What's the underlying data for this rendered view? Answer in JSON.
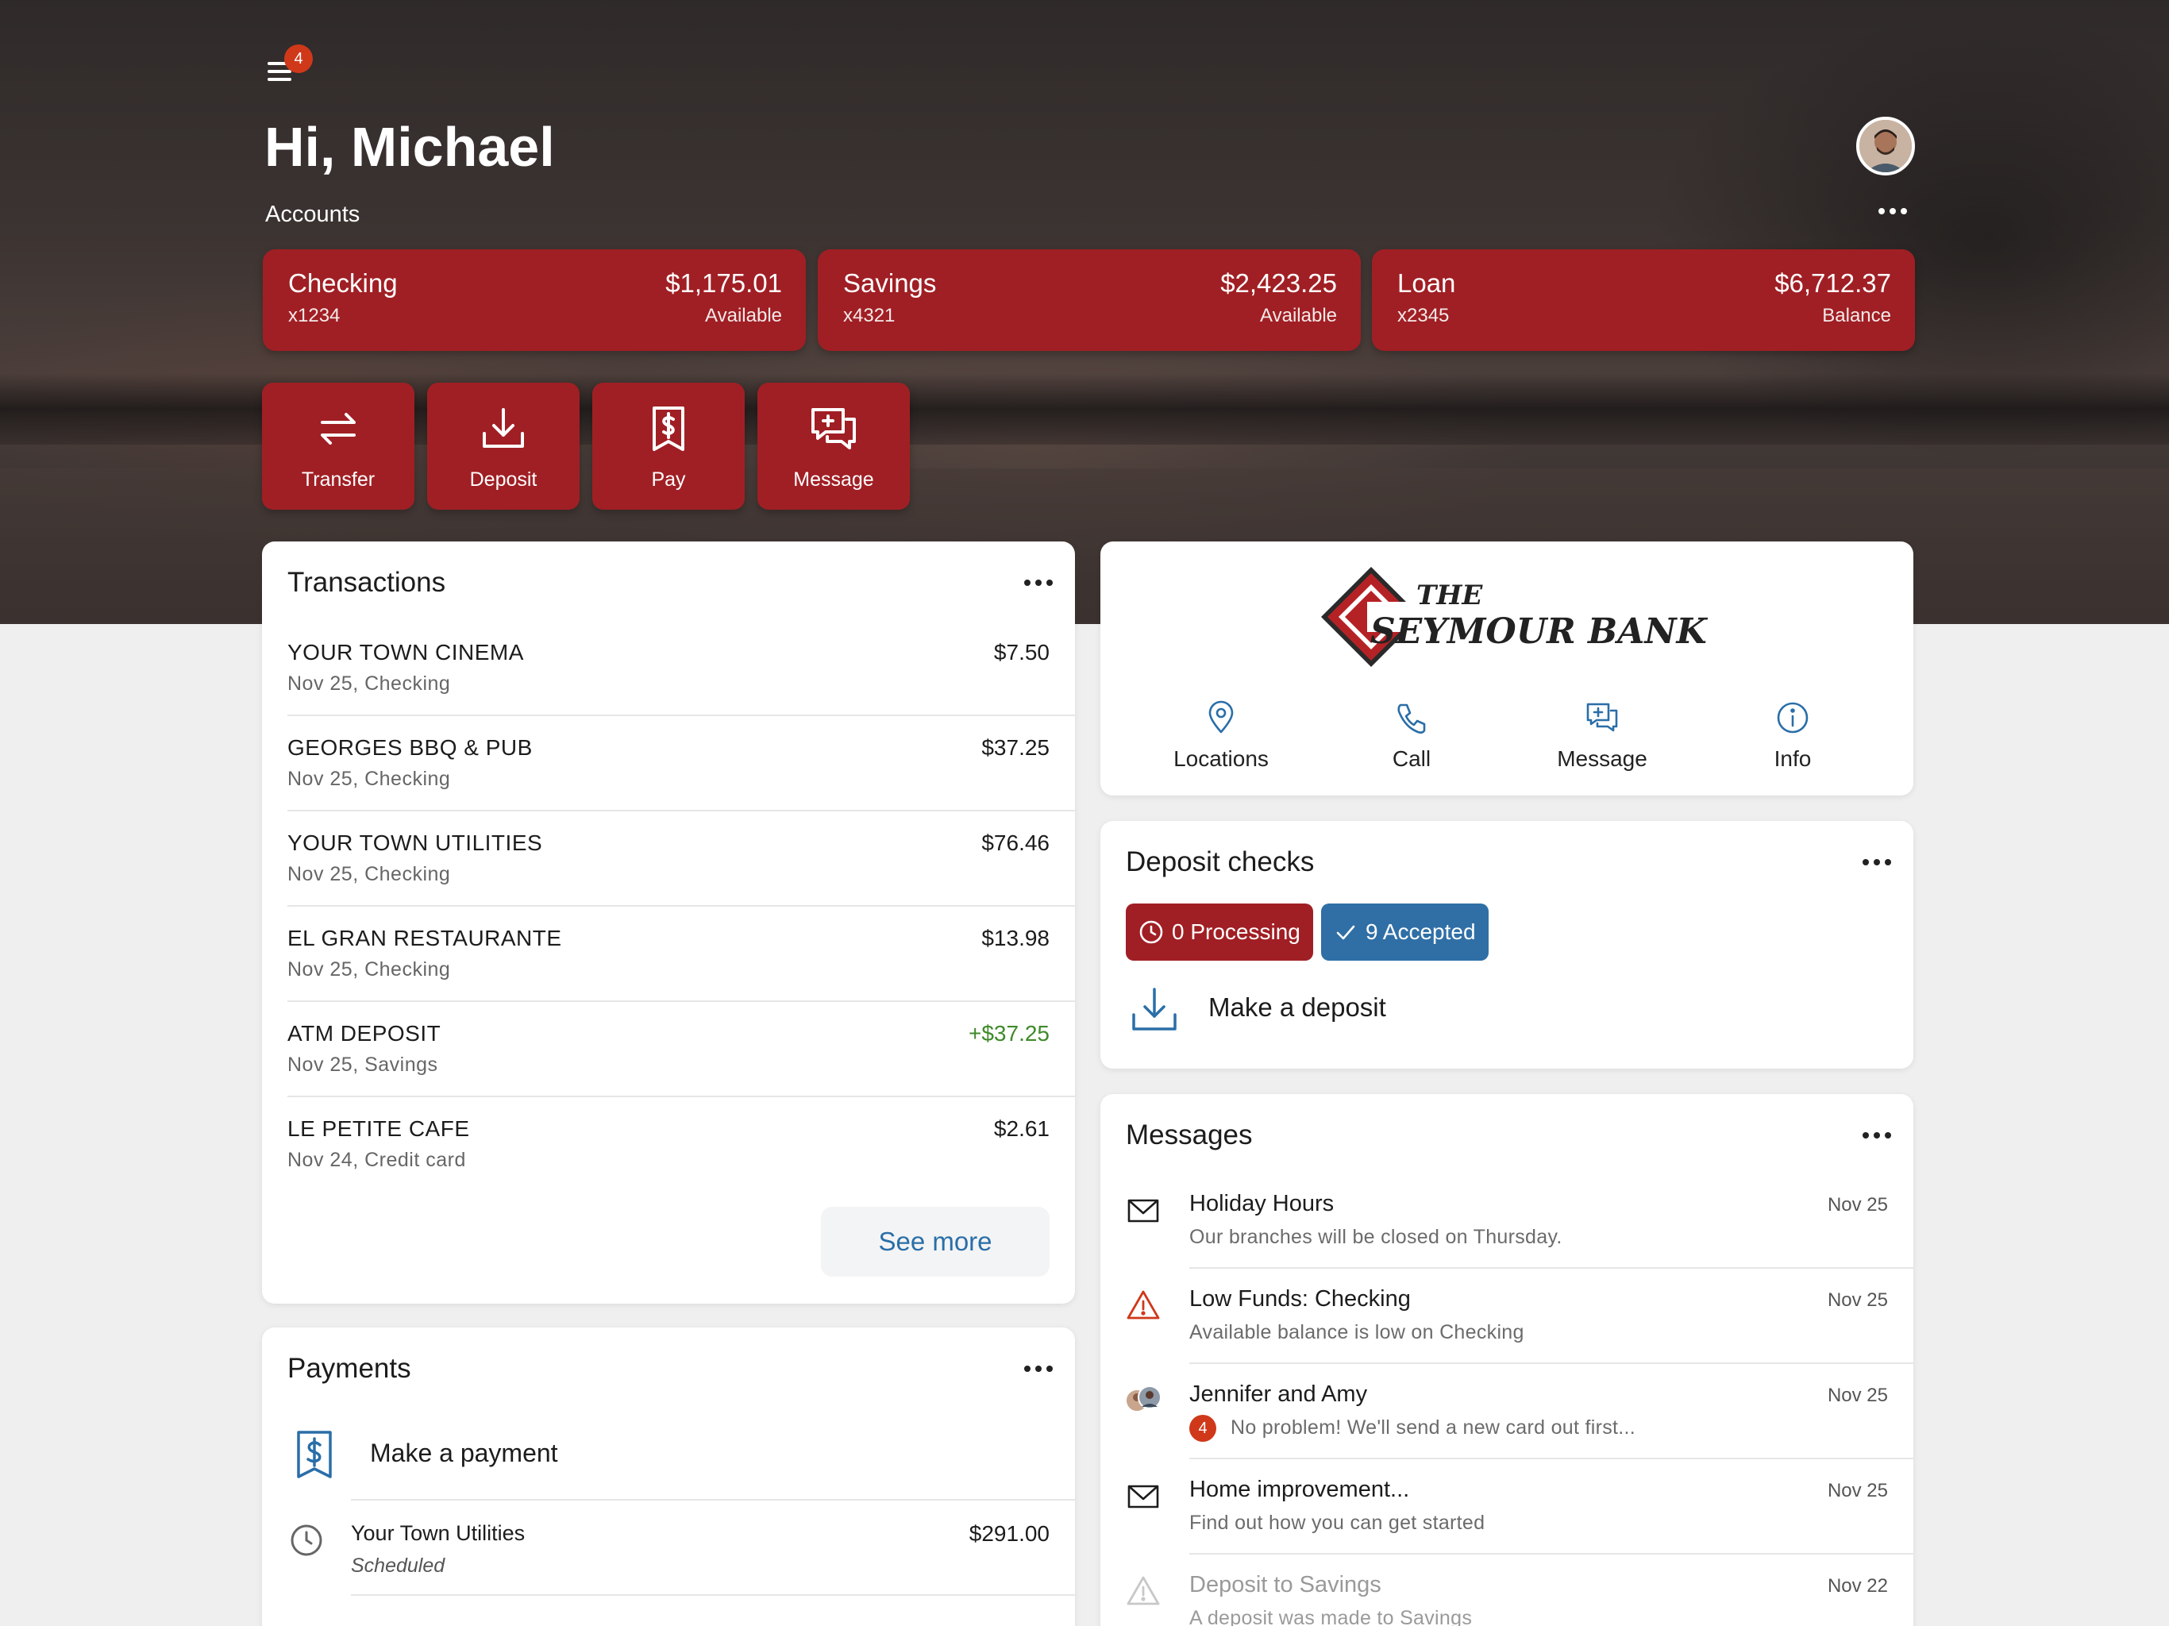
{
  "header": {
    "menu_badge": "4",
    "greeting": "Hi, Michael",
    "accounts_label": "Accounts"
  },
  "accounts": [
    {
      "name": "Checking",
      "number": "x1234",
      "amount": "$1,175.01",
      "sub": "Available"
    },
    {
      "name": "Savings",
      "number": "x4321",
      "amount": "$2,423.25",
      "sub": "Available"
    },
    {
      "name": "Loan",
      "number": "x2345",
      "amount": "$6,712.37",
      "sub": "Balance"
    }
  ],
  "actions": [
    {
      "label": "Transfer",
      "icon": "transfer-icon"
    },
    {
      "label": "Deposit",
      "icon": "deposit-icon"
    },
    {
      "label": "Pay",
      "icon": "pay-icon"
    },
    {
      "label": "Message",
      "icon": "message-icon"
    }
  ],
  "transactions": {
    "title": "Transactions",
    "items": [
      {
        "merchant": "YOUR TOWN CINEMA",
        "detail": "Nov 25, Checking",
        "amount": "$7.50"
      },
      {
        "merchant": "GEORGES BBQ & PUB",
        "detail": "Nov 25, Checking",
        "amount": "$37.25"
      },
      {
        "merchant": "YOUR TOWN UTILITIES",
        "detail": "Nov 25, Checking",
        "amount": "$76.46"
      },
      {
        "merchant": "EL GRAN RESTAURANTE",
        "detail": "Nov 25, Checking",
        "amount": "$13.98"
      },
      {
        "merchant": "ATM DEPOSIT",
        "detail": "Nov 25, Savings",
        "amount": "+$37.25"
      },
      {
        "merchant": "LE PETITE CAFE",
        "detail": "Nov 24, Credit card",
        "amount": "$2.61"
      }
    ],
    "see_more": "See more"
  },
  "payments": {
    "title": "Payments",
    "make_payment": "Make a payment",
    "items": [
      {
        "payee": "Your Town Utilities",
        "status": "Scheduled",
        "amount": "$291.00"
      }
    ]
  },
  "bank": {
    "logo_line1": "THE",
    "logo_line2": "SEYMOUR BANK",
    "nav": [
      {
        "label": "Locations",
        "icon": "location-pin-icon"
      },
      {
        "label": "Call",
        "icon": "phone-icon"
      },
      {
        "label": "Message",
        "icon": "message-icon"
      },
      {
        "label": "Info",
        "icon": "info-icon"
      }
    ]
  },
  "deposit": {
    "title": "Deposit checks",
    "processing": "0 Processing",
    "accepted": "9 Accepted",
    "make_deposit": "Make a deposit"
  },
  "messages": {
    "title": "Messages",
    "items": [
      {
        "title": "Holiday Hours",
        "snippet": "Our branches will be closed on Thursday.",
        "date": "Nov 25",
        "icon": "envelope-icon"
      },
      {
        "title": "Low Funds: Checking",
        "snippet": "Available balance is low on Checking",
        "date": "Nov 25",
        "icon": "warning-icon"
      },
      {
        "title": "Jennifer and Amy",
        "snippet": "No problem! We'll send a new card out first...",
        "date": "Nov 25",
        "icon": "group-avatar-icon",
        "badge": "4"
      },
      {
        "title": "Home improvement...",
        "snippet": "Find out how you can get started",
        "date": "Nov 25",
        "icon": "envelope-icon"
      },
      {
        "title": "Deposit to Savings",
        "snippet": "A deposit was made to Savings",
        "date": "Nov 22",
        "icon": "warning-icon"
      }
    ]
  },
  "colors": {
    "brand_red": "#a01f24",
    "accent_blue": "#2a6ea8",
    "badge_orange": "#d0381a",
    "positive_green": "#3f8a2a"
  }
}
